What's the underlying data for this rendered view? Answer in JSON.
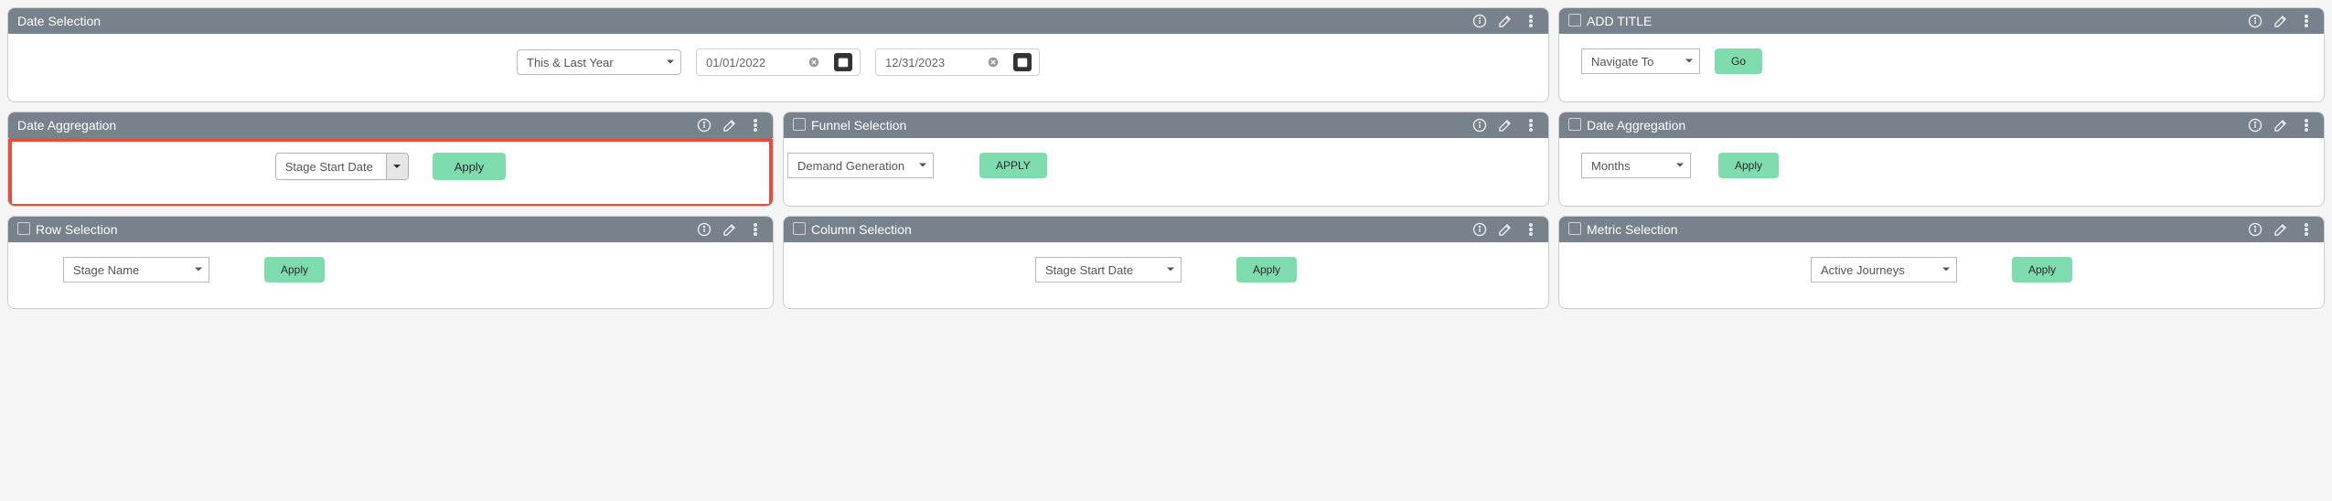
{
  "row1": {
    "dateSelection": {
      "title": "Date Selection",
      "range_label": "This & Last Year",
      "start_date": "01/01/2022",
      "end_date": "12/31/2023"
    },
    "addTitle": {
      "title": "ADD TITLE",
      "nav_label": "Navigate To",
      "go_label": "Go"
    }
  },
  "row2": {
    "dateAgg1": {
      "title": "Date Aggregation",
      "select_value": "Stage Start Date",
      "apply_label": "Apply"
    },
    "funnel": {
      "title": "Funnel Selection",
      "select_value": "Demand Generation",
      "apply_label": "APPLY"
    },
    "dateAgg2": {
      "title": "Date Aggregation",
      "select_value": "Months",
      "apply_label": "Apply"
    }
  },
  "row3": {
    "rowSel": {
      "title": "Row Selection",
      "select_value": "Stage Name",
      "apply_label": "Apply"
    },
    "colSel": {
      "title": "Column Selection",
      "select_value": "Stage Start Date",
      "apply_label": "Apply"
    },
    "metricSel": {
      "title": "Metric Selection",
      "select_value": "Active Journeys",
      "apply_label": "Apply"
    }
  }
}
